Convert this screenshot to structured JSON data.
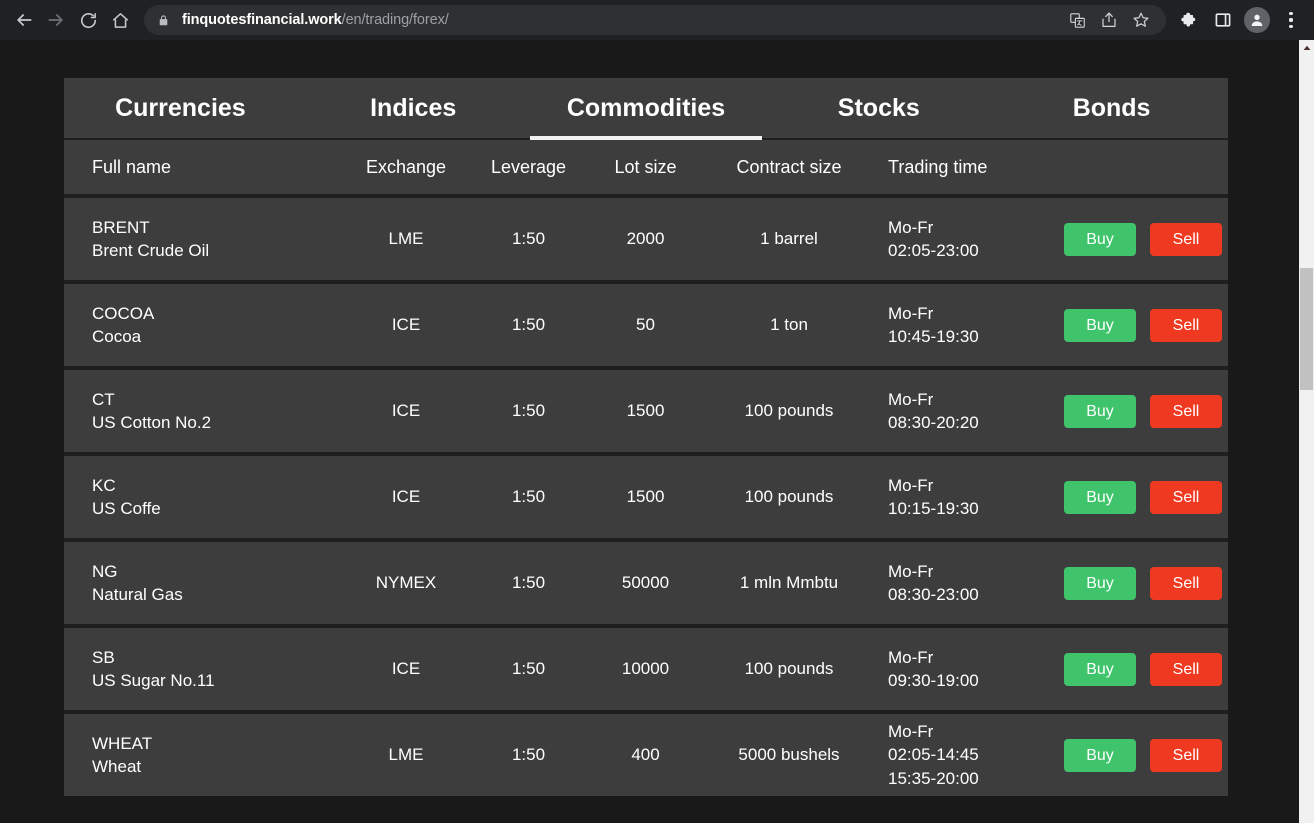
{
  "browser": {
    "back_label": "Back",
    "forward_label": "Forward",
    "reload_label": "Reload",
    "home_label": "Home",
    "url_domain": "finquotesfinancial.work",
    "url_path": "/en/trading/forex/",
    "lock_icon": "lock-icon",
    "translate_icon": "translate-icon",
    "share_icon": "share-icon",
    "bookmark_icon": "bookmark-star-icon",
    "extensions_icon": "extensions-puzzle-icon",
    "side_panel_icon": "side-panel-icon",
    "profile_icon": "profile-avatar-icon",
    "menu_icon": "three-dot-menu-icon"
  },
  "tabs": [
    {
      "label": "Currencies",
      "active": false
    },
    {
      "label": "Indices",
      "active": false
    },
    {
      "label": "Commodities",
      "active": true
    },
    {
      "label": "Stocks",
      "active": false
    },
    {
      "label": "Bonds",
      "active": false
    }
  ],
  "table": {
    "headers": {
      "full_name": "Full name",
      "exchange": "Exchange",
      "leverage": "Leverage",
      "lot_size": "Lot size",
      "contract_size": "Contract size",
      "trading_time": "Trading time"
    },
    "buy_label": "Buy",
    "sell_label": "Sell",
    "rows": [
      {
        "symbol": "BRENT",
        "full_name": "Brent Crude Oil",
        "exchange": "LME",
        "leverage": "1:50",
        "lot_size": "2000",
        "contract_size": "1 barrel",
        "trading_time": [
          "Mo-Fr",
          "02:05-23:00"
        ]
      },
      {
        "symbol": "COCOA",
        "full_name": "Cocoa",
        "exchange": "ICE",
        "leverage": "1:50",
        "lot_size": "50",
        "contract_size": "1 ton",
        "trading_time": [
          "Mo-Fr",
          "10:45-19:30"
        ]
      },
      {
        "symbol": "CT",
        "full_name": "US Cotton No.2",
        "exchange": "ICE",
        "leverage": "1:50",
        "lot_size": "1500",
        "contract_size": "100 pounds",
        "trading_time": [
          "Mo-Fr",
          "08:30-20:20"
        ]
      },
      {
        "symbol": "KC",
        "full_name": "US Coffe",
        "exchange": "ICE",
        "leverage": "1:50",
        "lot_size": "1500",
        "contract_size": "100 pounds",
        "trading_time": [
          "Mo-Fr",
          "10:15-19:30"
        ]
      },
      {
        "symbol": "NG",
        "full_name": "Natural Gas",
        "exchange": "NYMEX",
        "leverage": "1:50",
        "lot_size": "50000",
        "contract_size": "1 mln Mmbtu",
        "trading_time": [
          "Mo-Fr",
          "08:30-23:00"
        ]
      },
      {
        "symbol": "SB",
        "full_name": "US Sugar No.11",
        "exchange": "ICE",
        "leverage": "1:50",
        "lot_size": "10000",
        "contract_size": "100 pounds",
        "trading_time": [
          "Mo-Fr",
          "09:30-19:00"
        ]
      },
      {
        "symbol": "WHEAT",
        "full_name": "Wheat",
        "exchange": "LME",
        "leverage": "1:50",
        "lot_size": "400",
        "contract_size": "5000 bushels",
        "trading_time": [
          "Mo-Fr",
          "02:05-14:45",
          "15:35-20:00"
        ]
      }
    ]
  },
  "colors": {
    "page_background": "#191919",
    "panel_background": "#3d3d3d",
    "row_divider": "#1f1f1f",
    "buy_green": "#3fc46c",
    "sell_red": "#ef3a21",
    "active_tab_underline": "#f1f1f1"
  }
}
